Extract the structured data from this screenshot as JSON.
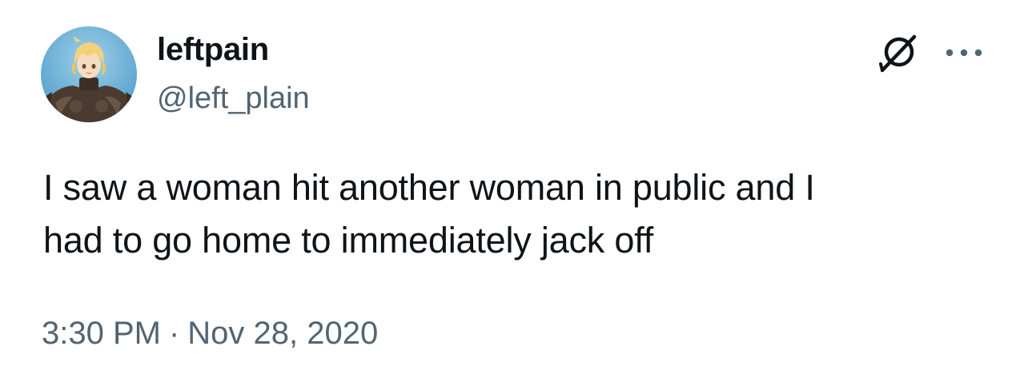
{
  "user": {
    "display_name": "leftpain",
    "handle": "@left_plain",
    "avatar_icon": "avatar-anime-character-armor"
  },
  "icons": {
    "grok": "grok-icon",
    "more": "more-options-icon"
  },
  "tweet": {
    "text": "I saw a woman hit another woman in public and I\nhad to go home to immediately jack off",
    "time": "3:30 PM",
    "separator": "·",
    "date": "Nov 28, 2020"
  },
  "colors": {
    "primary_text": "#0f1419",
    "secondary_text": "#536471",
    "background": "#ffffff"
  }
}
